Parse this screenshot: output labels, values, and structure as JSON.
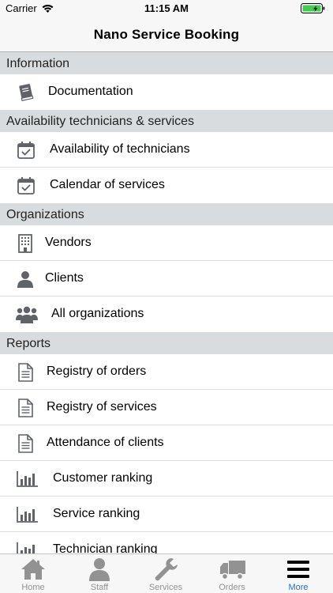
{
  "status_bar": {
    "carrier": "Carrier",
    "time": "11:15 AM"
  },
  "nav": {
    "title": "Nano Service Booking"
  },
  "sections": [
    {
      "title": "Information",
      "items": [
        {
          "label": "Documentation",
          "icon": "book-icon"
        }
      ]
    },
    {
      "title": "Availability technicians & services",
      "items": [
        {
          "label": "Availability of technicians",
          "icon": "calendar-check-icon"
        },
        {
          "label": "Calendar of services",
          "icon": "calendar-check-icon"
        }
      ]
    },
    {
      "title": "Organizations",
      "items": [
        {
          "label": "Vendors",
          "icon": "building-icon"
        },
        {
          "label": "Clients",
          "icon": "user-icon"
        },
        {
          "label": "All organizations",
          "icon": "users-icon"
        }
      ]
    },
    {
      "title": "Reports",
      "items": [
        {
          "label": "Registry of orders",
          "icon": "document-icon"
        },
        {
          "label": "Registry of services",
          "icon": "document-icon"
        },
        {
          "label": "Attendance of clients",
          "icon": "document-icon"
        },
        {
          "label": "Customer ranking",
          "icon": "bar-chart-icon"
        },
        {
          "label": "Service ranking",
          "icon": "bar-chart-icon"
        },
        {
          "label": "Technician ranking",
          "icon": "bar-chart-icon"
        }
      ]
    }
  ],
  "tabs": [
    {
      "label": "Home",
      "icon": "home-icon",
      "active": false
    },
    {
      "label": "Staff",
      "icon": "person-icon",
      "active": false
    },
    {
      "label": "Services",
      "icon": "wrench-icon",
      "active": false
    },
    {
      "label": "Orders",
      "icon": "truck-icon",
      "active": false
    },
    {
      "label": "More",
      "icon": "menu-icon",
      "active": true
    }
  ],
  "colors": {
    "active_tab": "#1a73d9",
    "section_header_bg": "#d8dcde",
    "inactive_tab": "#929292"
  }
}
